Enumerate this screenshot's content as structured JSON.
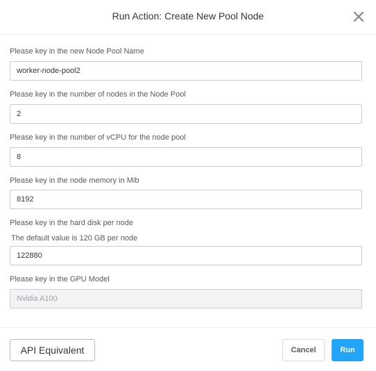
{
  "dialog": {
    "title": "Run Action: Create New Pool Node",
    "close_icon": "close-icon"
  },
  "fields": [
    {
      "label": "Please key in the new Node Pool Name",
      "value": "worker-node-pool2",
      "disabled": false
    },
    {
      "label": "Please key in the number of nodes in the Node Pool",
      "value": "2",
      "disabled": false
    },
    {
      "label": "Please key in the number of vCPU for the node pool",
      "value": "8",
      "disabled": false
    },
    {
      "label": "Please key in the node memory in Mib",
      "value": "8192",
      "disabled": false
    },
    {
      "label": "Please key in the hard disk per node",
      "sublabel": "The default value is 120 GB per node",
      "value": "122880",
      "disabled": false
    },
    {
      "label": "Please key in the GPU Model",
      "value": "Nvidia A100",
      "disabled": true
    }
  ],
  "footer": {
    "api_label": "API Equivalent",
    "cancel_label": "Cancel",
    "run_label": "Run"
  },
  "colors": {
    "primary": "#22a5f7",
    "border": "#c7ccd1",
    "disabled_bg": "#f2f3f4"
  }
}
